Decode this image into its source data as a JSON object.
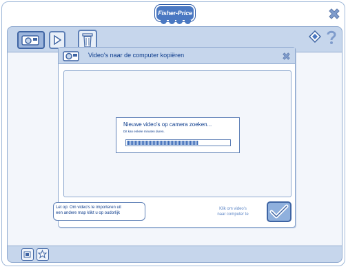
{
  "app": {
    "logo": "Fisher-Price"
  },
  "toolbar": {
    "buttons": [
      {
        "icon": "camera-icon",
        "active": true
      },
      {
        "icon": "play-icon",
        "active": false
      },
      {
        "icon": "trash-icon",
        "active": false
      }
    ],
    "right_icons": [
      "diamond-nav-icon",
      "help-icon"
    ]
  },
  "dialog": {
    "title": "Video's naar de computer kopiëren",
    "message": {
      "title": "Nieuwe video's op camera zoeken...",
      "subtitle": "Dit kan enkele minuten duren.",
      "progress": 0.7
    },
    "note_line1": "Let op: Om video's te importeren uit",
    "note_line2": "een andere map klikt u op oudorlijk",
    "hint_line1": "Klik om video's",
    "hint_line2": "naar computer te"
  },
  "colors": {
    "accent": "#4a78c2",
    "toolbar": "#c6d6ec",
    "text": "#0d3c8c"
  }
}
